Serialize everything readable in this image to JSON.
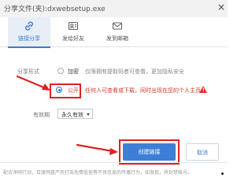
{
  "window": {
    "title": "分享文件(夹):dxwebsetup.exe",
    "close_glyph": "×"
  },
  "tabs": [
    {
      "label": "链接分享",
      "icon": "link-icon",
      "active": true
    },
    {
      "label": "发给好友",
      "icon": "contacts-icon",
      "active": false
    },
    {
      "label": "发到邮箱",
      "icon": "mail-icon",
      "active": false
    }
  ],
  "share_form": {
    "label": "分享形式",
    "options": [
      {
        "label": "加密",
        "description": "仅限拥有提取码者可查看，更加隐私安全",
        "selected": false
      },
      {
        "label": "公开",
        "description": "任何人可查看或下载，同时出现在您的个人主页",
        "selected": true
      }
    ]
  },
  "validity": {
    "label": "有效期",
    "selected": "永久有效"
  },
  "actions": {
    "create_label": "创建链接",
    "cancel_label": "取消"
  },
  "footer": {
    "text": "配合净网行动，百度网盘严厉打击色情低俗等不良信息的传播行为，如发现，将封禁帐号。"
  },
  "colors": {
    "accent": "#3d7fd6",
    "annotation_red": "#e02020",
    "warning_text": "#d43b2c"
  }
}
